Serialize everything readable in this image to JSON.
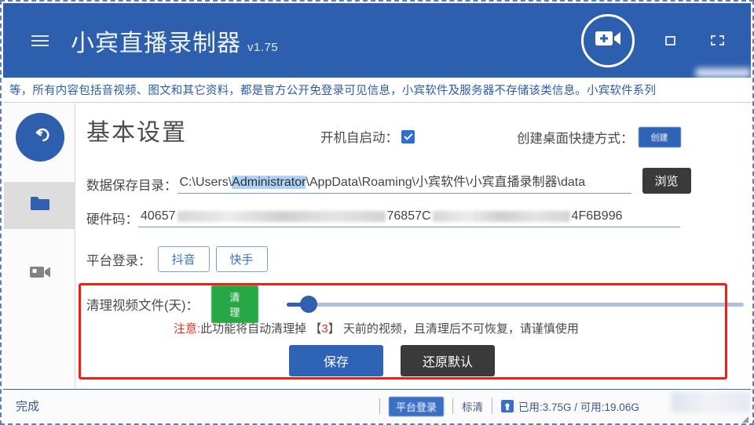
{
  "window": {
    "title": "小宾直播录制器",
    "version": "v1.75",
    "menu_icon": "hamburger-icon",
    "record_icon": "video-camera-plus-icon",
    "minimize_icon": "square-icon",
    "restore_icon": "dashed-square-icon"
  },
  "notice": {
    "text": "等，所有内容包括音视频、图文和其它资料，都是官方公开免登录可见信息，小宾软件及服务器不存储该类信息。小宾软件系列"
  },
  "sidebar": {
    "items": [
      {
        "name": "back",
        "icon": "back-arrow-icon"
      },
      {
        "name": "files",
        "icon": "folder-icon"
      },
      {
        "name": "recorder",
        "icon": "video-camera-icon"
      }
    ]
  },
  "main": {
    "page_title": "基本设置",
    "autostart": {
      "label": "开机自启动：",
      "checked": true
    },
    "shortcut": {
      "label": "创建桌面快捷方式：",
      "button": "创建"
    },
    "data_dir": {
      "label": "数据保存目录：",
      "prefix": "C:\\Users\\",
      "selected": "Administrator",
      "suffix": "\\AppData\\Roaming\\小宾软件\\小宾直播录制器\\data",
      "browse_button": "浏览"
    },
    "hardware": {
      "label": "硬件码：",
      "value_start": "40657",
      "value_mid": "76857C",
      "value_end": "4F6B996"
    },
    "platform_login": {
      "label": "平台登录：",
      "buttons": [
        "抖音",
        "快手"
      ]
    },
    "cleanup": {
      "label": "清理视频文件(天)：",
      "button": "清理",
      "slider_value": 3,
      "slider_min": 0,
      "slider_max": 90,
      "warn_prefix": "注意:",
      "warn_text_a": "此功能将自动清理掉 【",
      "warn_days": "3",
      "warn_text_b": "】 天前的视频，且清理后不可恢复，请谨慎使用"
    },
    "actions": {
      "save": "保存",
      "restore": "还原默认"
    }
  },
  "statusbar": {
    "status": "完成",
    "platform_login_badge": "平台登录",
    "quality": "标清",
    "disk_icon": "disk-icon",
    "storage": "已用:3.75G / 可用:19.06G"
  },
  "colors": {
    "brand_blue": "#2e5fae",
    "accent_blue": "#2f63b5",
    "green": "#27a745",
    "warn_red": "#e03020",
    "highlight_red": "#fb1b10",
    "selection_blue": "#aed3f7"
  }
}
